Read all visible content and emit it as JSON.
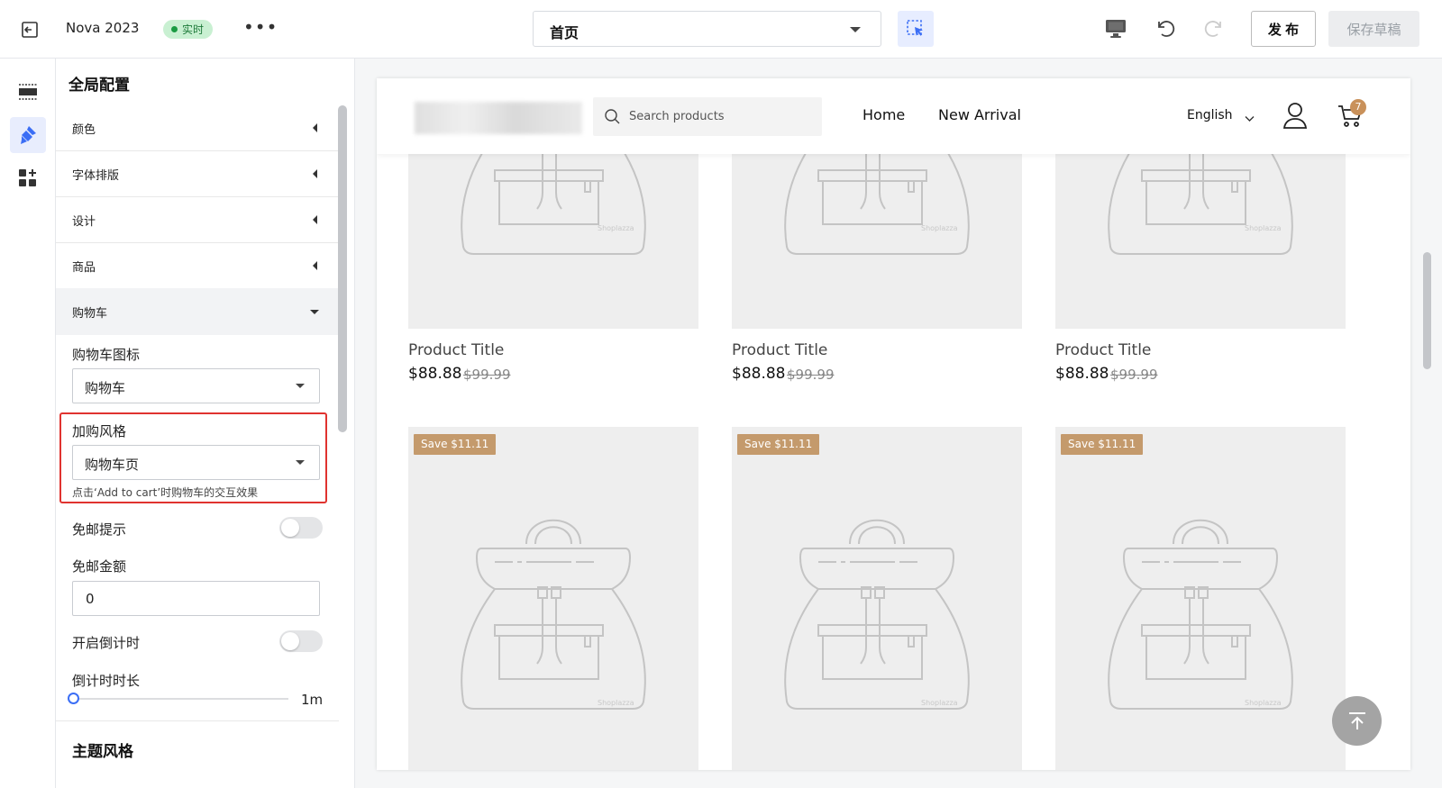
{
  "topbar": {
    "store_name": "Nova 2023",
    "live_label": "实时",
    "page_select_value": "首页",
    "publish_label": "发 布",
    "save_draft_label": "保存草稿"
  },
  "panel": {
    "title": "全局配置",
    "sections": [
      "颜色",
      "字体排版",
      "设计",
      "商品",
      "购物车"
    ],
    "cart_icon_label": "购物车图标",
    "cart_icon_value": "购物车",
    "add_style_label": "加购风格",
    "add_style_value": "购物车页",
    "add_style_hint": "点击‘Add to cart’时购物车的交互效果",
    "free_shipping_tip_label": "免邮提示",
    "free_shipping_tip_on": false,
    "free_shipping_amount_label": "免邮金额",
    "free_shipping_amount_value": "0",
    "countdown_enable_label": "开启倒计时",
    "countdown_enable_on": false,
    "countdown_duration_label": "倒计时时长",
    "countdown_duration_value": "1m",
    "theme_style_title": "主题风格"
  },
  "shop": {
    "search_placeholder": "Search products",
    "nav": [
      "Home",
      "New Arrival"
    ],
    "language": "English",
    "cart_count": "7",
    "products_row1": [
      {
        "title": "Product Title",
        "price": "$88.88",
        "old_price": "$99.99"
      },
      {
        "title": "Product Title",
        "price": "$88.88",
        "old_price": "$99.99"
      },
      {
        "title": "Product Title",
        "price": "$88.88",
        "old_price": "$99.99"
      }
    ],
    "products_row2": [
      {
        "tag": "Save $11.11",
        "watermark": "Shoplazza"
      },
      {
        "tag": "Save $11.11",
        "watermark": "Shoplazza"
      },
      {
        "tag": "Save $11.11",
        "watermark": "Shoplazza"
      }
    ],
    "watermark": "Shoplazza"
  },
  "colors": {
    "accent": "#3b6ef5",
    "highlight_border": "#e0332f",
    "save_tag": "#c49a6c",
    "live_badge_bg": "#c9f0d2"
  }
}
